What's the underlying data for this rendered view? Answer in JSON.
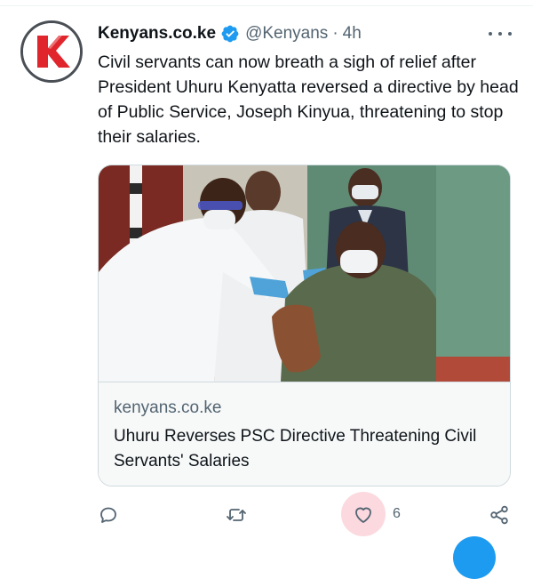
{
  "tweet": {
    "display_name": "Kenyans.co.ke",
    "verified": true,
    "handle": "@Kenyans",
    "separator": "·",
    "time": "4h",
    "text": "Civil servants can now breath a sigh of relief after President Uhuru Kenyatta reversed a directive by head of Public Service, Joseph Kinyua, threatening to stop their salaries.",
    "avatar_logo_letter": "K"
  },
  "card": {
    "domain": "kenyans.co.ke",
    "title": "Uhuru Reverses PSC Directive Threatening Civil Servants' Salaries"
  },
  "actions": {
    "like_count": "6",
    "like_active": true
  },
  "colors": {
    "verified_blue": "#1d9bf0",
    "like_highlight": "#fbd9df",
    "brand_red": "#e0252c"
  },
  "icons": [
    "verified-badge-icon",
    "more-icon",
    "reply-icon",
    "retweet-icon",
    "like-icon",
    "share-icon"
  ]
}
